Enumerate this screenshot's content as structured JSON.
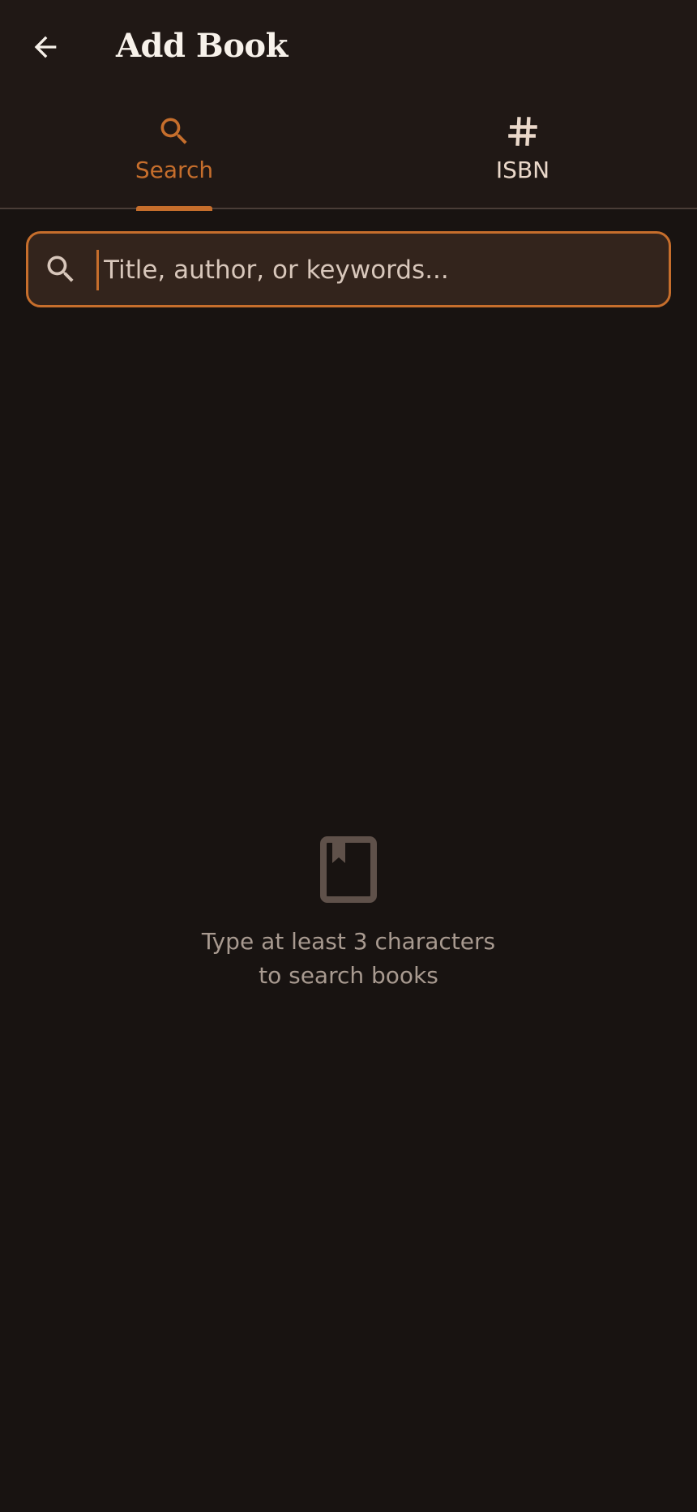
{
  "header": {
    "title": "Add Book",
    "back_icon": "arrow-back-icon"
  },
  "tabs": [
    {
      "label": "Search",
      "icon": "search-icon",
      "selected": true
    },
    {
      "label": "ISBN",
      "icon": "hash-icon",
      "selected": false
    }
  ],
  "search": {
    "value": "",
    "placeholder": "Title, author, or keywords..."
  },
  "empty_state": {
    "icon": "book-icon",
    "line1": "Type at least 3 characters",
    "line2": "to search books"
  },
  "colors": {
    "background": "#181311",
    "app_bar": "#201815",
    "accent": "#c66e2c",
    "input_fill": "#33241c",
    "muted_text": "#a89a90",
    "icon_muted": "#5f514a"
  }
}
